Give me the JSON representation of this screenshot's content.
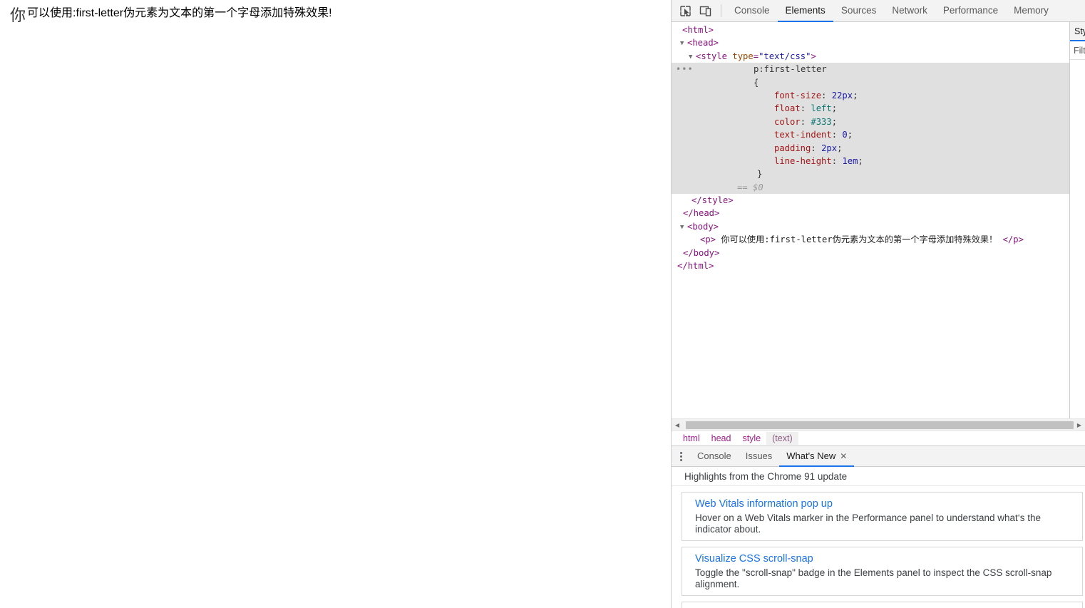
{
  "page": {
    "paragraph_first_letter": "你",
    "paragraph_rest": "可以使用:first-letter伪元素为文本的第一个字母添加特殊效果!"
  },
  "devtools": {
    "toolbar_icons": [
      {
        "name": "inspect-element-icon",
        "label": "inspect-element"
      },
      {
        "name": "device-toolbar-icon",
        "label": "device-toolbar"
      }
    ],
    "tabs": [
      {
        "label": "Console",
        "selected": false
      },
      {
        "label": "Elements",
        "selected": true
      },
      {
        "label": "Sources",
        "selected": false
      },
      {
        "label": "Network",
        "selected": false
      },
      {
        "label": "Performance",
        "selected": false
      },
      {
        "label": "Memory",
        "selected": false
      }
    ],
    "dom_tree": {
      "line_html_open": "<html>",
      "line_head_open": "<head>",
      "style_tag_open": "<style",
      "style_attr_name": "type",
      "style_attr_value": "\"text/css\"",
      "style_tag_close": ">",
      "selector": "p:first-letter",
      "brace_open": "{",
      "declarations": [
        {
          "prop": "font-size",
          "value": "22px",
          "kind": "num"
        },
        {
          "prop": "float",
          "value": "left",
          "kind": "kw"
        },
        {
          "prop": "color",
          "value": "#333",
          "kind": "kw"
        },
        {
          "prop": "text-indent",
          "value": "0",
          "kind": "num"
        },
        {
          "prop": "padding",
          "value": "2px",
          "kind": "num"
        },
        {
          "prop": "line-height",
          "value": "1em",
          "kind": "num"
        }
      ],
      "brace_close": "}",
      "selected_marker": "== $0",
      "line_style_close": "</style>",
      "line_head_close": "</head>",
      "line_body_open": "<body>",
      "p_open": "<p>",
      "p_text": " 你可以使用:first-letter伪元素为文本的第一个字母添加特殊效果！ ",
      "p_close": "</p>",
      "line_body_close": "</body>",
      "line_html_close": "</html>"
    },
    "styles_sliver": {
      "tab_label": "Styles",
      "filter_placeholder": "Filter"
    },
    "hscroll": {
      "left_arrow": "◀",
      "right_arrow": "▶"
    },
    "breadcrumbs": [
      {
        "label": "html",
        "selected": false
      },
      {
        "label": "head",
        "selected": false
      },
      {
        "label": "style",
        "selected": false
      },
      {
        "label": "(text)",
        "selected": true
      }
    ],
    "drawer": {
      "more_icon": "more-vertical-icon",
      "tabs": [
        {
          "label": "Console",
          "selected": false,
          "closable": false
        },
        {
          "label": "Issues",
          "selected": false,
          "closable": false
        },
        {
          "label": "What's New",
          "selected": true,
          "closable": true,
          "close_glyph": "✕"
        }
      ],
      "subtitle": "Highlights from the Chrome 91 update",
      "cards": [
        {
          "title": "Web Vitals information pop up",
          "description": "Hover on a Web Vitals marker in the Performance panel to understand what‘s the\nindicator about."
        },
        {
          "title": "Visualize CSS scroll-snap",
          "description": "Toggle the \"scroll-snap\" badge in the Elements panel to inspect the CSS scroll-snap\nalignment."
        }
      ]
    }
  },
  "colors": {
    "accent": "#1a73e8",
    "tab_bg": "#f3f3f3",
    "selected_node_bg": "#e0e0e0",
    "tag_purple": "#881280",
    "attr_orange": "#994500",
    "attr_value_blue": "#1a1aa6",
    "css_prop_red": "#a31515",
    "css_keyword_teal": "#0b7575",
    "link_blue": "#1a73e8"
  }
}
